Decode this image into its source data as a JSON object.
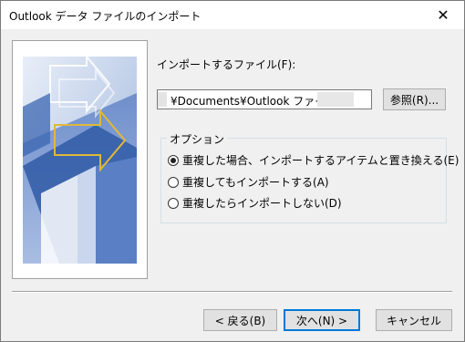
{
  "window": {
    "title": "Outlook データ ファイルのインポート",
    "close_glyph": "✕"
  },
  "main": {
    "file_label": "インポートするファイル(F):",
    "file_path": "¥Documents¥Outlook ファイル¥",
    "browse_label": "参照(R)..."
  },
  "options": {
    "group_title": "オプション",
    "items": [
      {
        "label": "重複した場合、インポートするアイテムと置き換える(E)",
        "selected": true
      },
      {
        "label": "重複してもインポートする(A)",
        "selected": false
      },
      {
        "label": "重複したらインポートしない(D)",
        "selected": false
      }
    ]
  },
  "footer": {
    "back_label": "< 戻る(B)",
    "next_label": "次へ(N) >",
    "cancel_label": "キャンセル"
  },
  "colors": {
    "accent": "#0078d7",
    "wizard_blue": "#2f5aa6",
    "arrow_yellow": "#e0b83a"
  }
}
